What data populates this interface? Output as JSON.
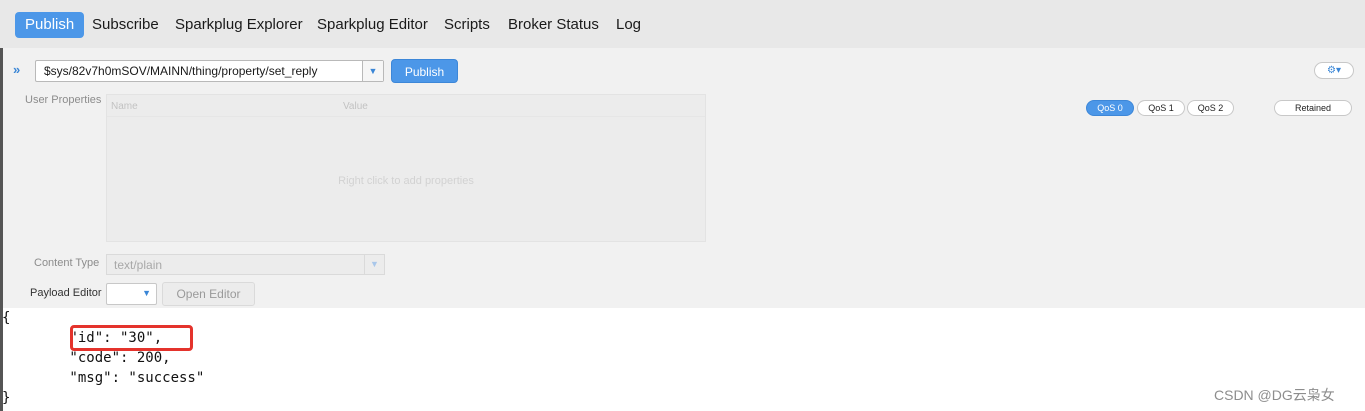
{
  "tabs": [
    {
      "label": "Publish",
      "active": true
    },
    {
      "label": "Subscribe",
      "active": false
    },
    {
      "label": "Sparkplug Explorer",
      "active": false
    },
    {
      "label": "Sparkplug Editor",
      "active": false
    },
    {
      "label": "Scripts",
      "active": false
    },
    {
      "label": "Broker Status",
      "active": false
    },
    {
      "label": "Log",
      "active": false
    }
  ],
  "publish": {
    "expand_icon": "double-chevron-right-icon",
    "topic_value": "$sys/82v7h0mSOV/MAINN/thing/property/set_reply",
    "topic_dropdown_icon": "chevron-down-icon",
    "publish_label": "Publish",
    "settings_icon": "gear-icon",
    "settings_label": "⚙▾"
  },
  "user_properties": {
    "label": "User Properties",
    "columns": [
      "Name",
      "Value"
    ],
    "empty_hint": "Right click to add properties"
  },
  "qos": {
    "options": [
      "QoS 0",
      "QoS 1",
      "QoS 2"
    ],
    "selected": "QoS 0",
    "retained_label": "Retained"
  },
  "content_type": {
    "label": "Content Type",
    "value": "text/plain"
  },
  "payload_editor": {
    "label": "Payload Editor",
    "selected": "",
    "open_editor_label": "Open Editor"
  },
  "payload": {
    "lines": [
      "{",
      "        \"id\": \"30\",",
      "        \"code\": 200,",
      "        \"msg\": \"success\"",
      "}"
    ]
  },
  "watermark": "CSDN @DG云枭女",
  "colors": {
    "accent": "#4c97e8",
    "highlight_border": "#e4332c",
    "panel_bg": "#f1f1f1",
    "topbar_bg": "#e8e8e8"
  }
}
